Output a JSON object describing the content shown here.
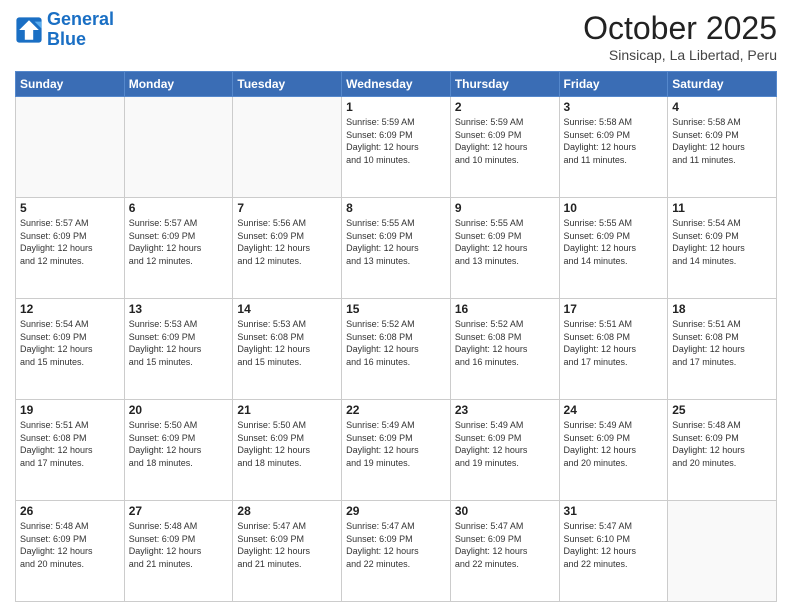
{
  "logo": {
    "line1": "General",
    "line2": "Blue"
  },
  "header": {
    "month": "October 2025",
    "location": "Sinsicap, La Libertad, Peru"
  },
  "weekdays": [
    "Sunday",
    "Monday",
    "Tuesday",
    "Wednesday",
    "Thursday",
    "Friday",
    "Saturday"
  ],
  "weeks": [
    [
      {
        "day": "",
        "info": ""
      },
      {
        "day": "",
        "info": ""
      },
      {
        "day": "",
        "info": ""
      },
      {
        "day": "1",
        "info": "Sunrise: 5:59 AM\nSunset: 6:09 PM\nDaylight: 12 hours\nand 10 minutes."
      },
      {
        "day": "2",
        "info": "Sunrise: 5:59 AM\nSunset: 6:09 PM\nDaylight: 12 hours\nand 10 minutes."
      },
      {
        "day": "3",
        "info": "Sunrise: 5:58 AM\nSunset: 6:09 PM\nDaylight: 12 hours\nand 11 minutes."
      },
      {
        "day": "4",
        "info": "Sunrise: 5:58 AM\nSunset: 6:09 PM\nDaylight: 12 hours\nand 11 minutes."
      }
    ],
    [
      {
        "day": "5",
        "info": "Sunrise: 5:57 AM\nSunset: 6:09 PM\nDaylight: 12 hours\nand 12 minutes."
      },
      {
        "day": "6",
        "info": "Sunrise: 5:57 AM\nSunset: 6:09 PM\nDaylight: 12 hours\nand 12 minutes."
      },
      {
        "day": "7",
        "info": "Sunrise: 5:56 AM\nSunset: 6:09 PM\nDaylight: 12 hours\nand 12 minutes."
      },
      {
        "day": "8",
        "info": "Sunrise: 5:55 AM\nSunset: 6:09 PM\nDaylight: 12 hours\nand 13 minutes."
      },
      {
        "day": "9",
        "info": "Sunrise: 5:55 AM\nSunset: 6:09 PM\nDaylight: 12 hours\nand 13 minutes."
      },
      {
        "day": "10",
        "info": "Sunrise: 5:55 AM\nSunset: 6:09 PM\nDaylight: 12 hours\nand 14 minutes."
      },
      {
        "day": "11",
        "info": "Sunrise: 5:54 AM\nSunset: 6:09 PM\nDaylight: 12 hours\nand 14 minutes."
      }
    ],
    [
      {
        "day": "12",
        "info": "Sunrise: 5:54 AM\nSunset: 6:09 PM\nDaylight: 12 hours\nand 15 minutes."
      },
      {
        "day": "13",
        "info": "Sunrise: 5:53 AM\nSunset: 6:09 PM\nDaylight: 12 hours\nand 15 minutes."
      },
      {
        "day": "14",
        "info": "Sunrise: 5:53 AM\nSunset: 6:08 PM\nDaylight: 12 hours\nand 15 minutes."
      },
      {
        "day": "15",
        "info": "Sunrise: 5:52 AM\nSunset: 6:08 PM\nDaylight: 12 hours\nand 16 minutes."
      },
      {
        "day": "16",
        "info": "Sunrise: 5:52 AM\nSunset: 6:08 PM\nDaylight: 12 hours\nand 16 minutes."
      },
      {
        "day": "17",
        "info": "Sunrise: 5:51 AM\nSunset: 6:08 PM\nDaylight: 12 hours\nand 17 minutes."
      },
      {
        "day": "18",
        "info": "Sunrise: 5:51 AM\nSunset: 6:08 PM\nDaylight: 12 hours\nand 17 minutes."
      }
    ],
    [
      {
        "day": "19",
        "info": "Sunrise: 5:51 AM\nSunset: 6:08 PM\nDaylight: 12 hours\nand 17 minutes."
      },
      {
        "day": "20",
        "info": "Sunrise: 5:50 AM\nSunset: 6:09 PM\nDaylight: 12 hours\nand 18 minutes."
      },
      {
        "day": "21",
        "info": "Sunrise: 5:50 AM\nSunset: 6:09 PM\nDaylight: 12 hours\nand 18 minutes."
      },
      {
        "day": "22",
        "info": "Sunrise: 5:49 AM\nSunset: 6:09 PM\nDaylight: 12 hours\nand 19 minutes."
      },
      {
        "day": "23",
        "info": "Sunrise: 5:49 AM\nSunset: 6:09 PM\nDaylight: 12 hours\nand 19 minutes."
      },
      {
        "day": "24",
        "info": "Sunrise: 5:49 AM\nSunset: 6:09 PM\nDaylight: 12 hours\nand 20 minutes."
      },
      {
        "day": "25",
        "info": "Sunrise: 5:48 AM\nSunset: 6:09 PM\nDaylight: 12 hours\nand 20 minutes."
      }
    ],
    [
      {
        "day": "26",
        "info": "Sunrise: 5:48 AM\nSunset: 6:09 PM\nDaylight: 12 hours\nand 20 minutes."
      },
      {
        "day": "27",
        "info": "Sunrise: 5:48 AM\nSunset: 6:09 PM\nDaylight: 12 hours\nand 21 minutes."
      },
      {
        "day": "28",
        "info": "Sunrise: 5:47 AM\nSunset: 6:09 PM\nDaylight: 12 hours\nand 21 minutes."
      },
      {
        "day": "29",
        "info": "Sunrise: 5:47 AM\nSunset: 6:09 PM\nDaylight: 12 hours\nand 22 minutes."
      },
      {
        "day": "30",
        "info": "Sunrise: 5:47 AM\nSunset: 6:09 PM\nDaylight: 12 hours\nand 22 minutes."
      },
      {
        "day": "31",
        "info": "Sunrise: 5:47 AM\nSunset: 6:10 PM\nDaylight: 12 hours\nand 22 minutes."
      },
      {
        "day": "",
        "info": ""
      }
    ]
  ]
}
